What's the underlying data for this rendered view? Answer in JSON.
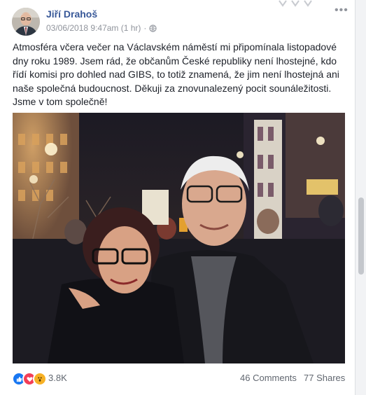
{
  "post": {
    "author": "Jiří Drahoš",
    "timestamp": "03/06/2018 9:47am (1 hr)",
    "body": "Atmosféra včera večer na Václavském náměstí mi připomínala listopadové dny roku 1989. Jsem rád, že občanům České republiky není lhostejné, kdo řídí komisi pro dohled nad GIBS, to totiž znamená, že jim není lhostejná ani naše společná budoucnost. Děkuji za znovunalezený pocit sounáležitosti. Jsme v tom společně!",
    "more_icon": "more-horizontal-icon",
    "privacy_icon": "globe-icon"
  },
  "engagement": {
    "reactions_count": "3.8K",
    "reaction_types": [
      "like-icon",
      "love-icon",
      "wow-icon"
    ],
    "comments": "46 Comments",
    "shares": "77 Shares"
  },
  "colors": {
    "link_blue": "#385898",
    "meta_gray": "#90949c",
    "like_blue": "#1877f2",
    "love_red": "#f33e58",
    "wow_yellow": "#f7b125"
  }
}
